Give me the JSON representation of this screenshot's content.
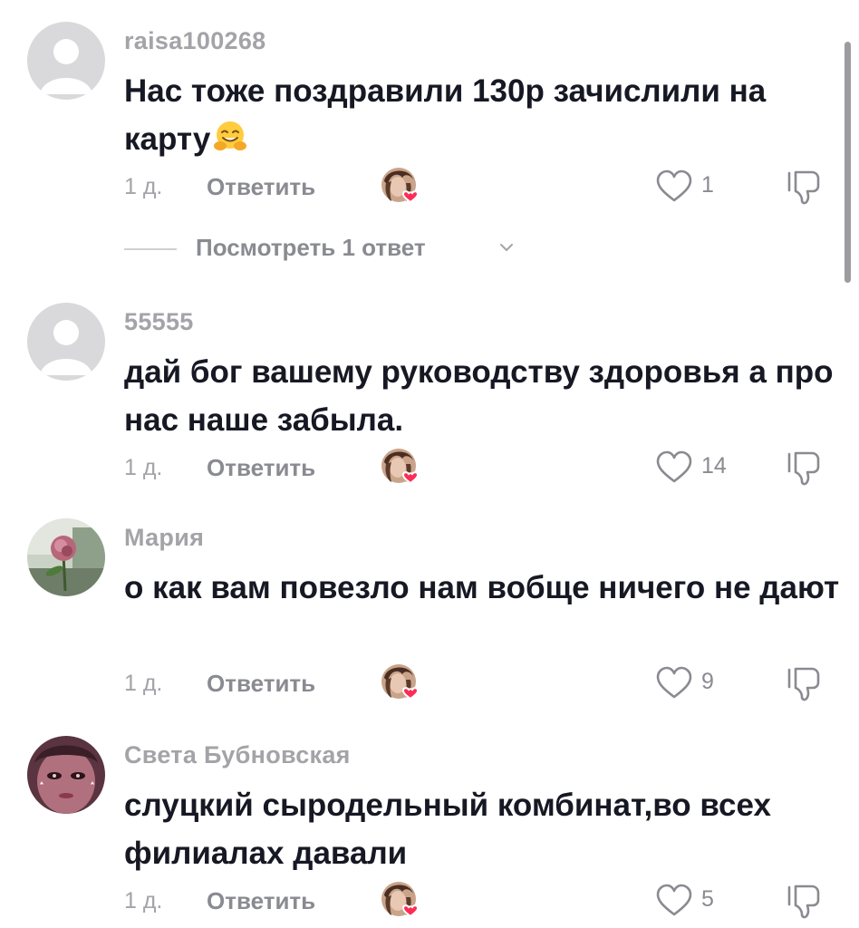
{
  "comments": [
    {
      "username": "raisa100268",
      "text": "Нас тоже поздравили 130р зачислили на карту",
      "emoji": "hugging-face-emoji",
      "time": "1 д.",
      "reply_label": "Ответить",
      "likes": "1",
      "view_replies": "Посмотреть 1 ответ",
      "avatar": "default-avatar"
    },
    {
      "username": "55555",
      "text": "дай бог вашему руководству здоровья а про нас наше забыла.",
      "time": "1 д.",
      "reply_label": "Ответить",
      "likes": "14",
      "avatar": "default-avatar"
    },
    {
      "username": "Мария",
      "text": "о как вам повезло нам вобще ничего не дают",
      "time": "1 д.",
      "reply_label": "Ответить",
      "likes": "9",
      "avatar": "rose-photo-avatar"
    },
    {
      "username": "Света Бубновская",
      "text": "слуцкий сыродельный комбинат,во всех филиалах давали",
      "time": "1 д.",
      "reply_label": "Ответить",
      "likes": "5",
      "avatar": "face-photo-avatar"
    }
  ],
  "icons": {
    "like": "heart-outline-icon",
    "dislike": "thumbs-down-icon",
    "creator_like": "creator-liked-badge-icon",
    "expand": "chevron-down-icon"
  },
  "colors": {
    "text": "#161823",
    "muted": "#a3a3a8",
    "action": "#8a8b91",
    "heart_badge": "#fe2c55"
  }
}
